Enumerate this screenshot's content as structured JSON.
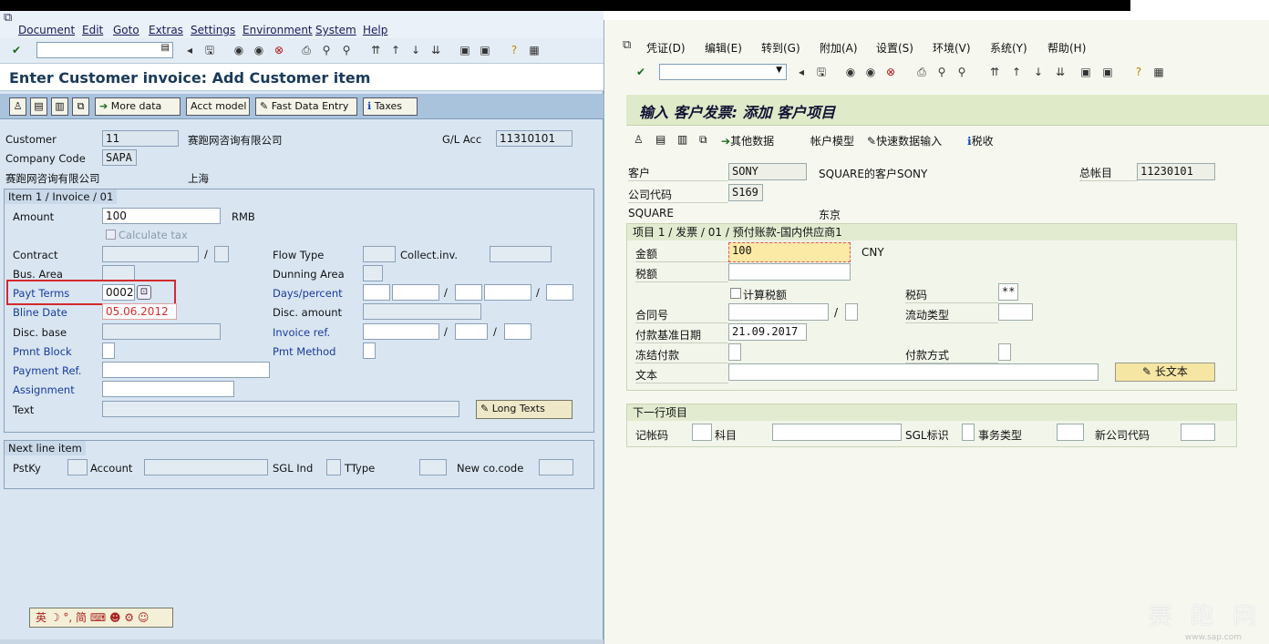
{
  "left": {
    "menu": [
      "Document",
      "Edit",
      "Goto",
      "Extras",
      "Settings",
      "Environment",
      "System",
      "Help"
    ],
    "title": "Enter Customer invoice: Add Customer item",
    "buttons": {
      "more_data": "More data",
      "acct_model": "Acct model",
      "fast_entry": "Fast Data Entry",
      "taxes": "Taxes",
      "long_texts": "Long Texts"
    },
    "header": {
      "customer_label": "Customer",
      "customer_value": "11",
      "customer_name": "赛跑网咨询有限公司",
      "gl_label": "G/L Acc",
      "gl_value": "11310101",
      "company_label": "Company Code",
      "company_value": "SAPA",
      "addr_name": "赛跑网咨询有限公司",
      "addr_city": "上海"
    },
    "item_group": {
      "title": "Item 1 / Invoice / 01",
      "amount_label": "Amount",
      "amount_value": "100",
      "currency": "RMB",
      "calc_tax": "Calculate tax",
      "contract_label": "Contract",
      "flow_type_label": "Flow Type",
      "collect_inv_label": "Collect.inv.",
      "bus_area_label": "Bus. Area",
      "dunning_label": "Dunning Area",
      "payt_terms_label": "Payt Terms",
      "payt_terms_value": "0002",
      "days_percent_label": "Days/percent",
      "bline_label": "Bline Date",
      "bline_value": "05.06.2012",
      "disc_amount_label": "Disc. amount",
      "disc_base_label": "Disc. base",
      "invoice_ref_label": "Invoice ref.",
      "pmnt_block_label": "Pmnt Block",
      "pmt_method_label": "Pmt Method",
      "payment_ref_label": "Payment Ref.",
      "assignment_label": "Assignment",
      "text_label": "Text"
    },
    "next_line": {
      "title": "Next line item",
      "pstky": "PstKy",
      "account": "Account",
      "sgl": "SGL Ind",
      "ttype": "TType",
      "new_co": "New co.code"
    },
    "ime": "英 ☽ °, 简 ⌨ ☻ ⚙ ☺"
  },
  "right": {
    "menu": [
      "凭证(D)",
      "编辑(E)",
      "转到(G)",
      "附加(A)",
      "设置(S)",
      "环境(V)",
      "系统(Y)",
      "帮助(H)"
    ],
    "title": "输入 客户发票: 添加 客户项目",
    "buttons": {
      "other_data": "其他数据",
      "acct_model": "帐户模型",
      "fast_entry": "快速数据输入",
      "tax": "税收",
      "long_text": "长文本"
    },
    "header": {
      "customer_label": "客户",
      "customer_value": "SONY",
      "customer_desc": "SQUARE的客户SONY",
      "gl_label": "总帐目",
      "gl_value": "11230101",
      "company_label": "公司代码",
      "company_value": "S169",
      "addr_name": "SQUARE",
      "addr_city": "东京"
    },
    "item_group": {
      "title": "项目 1 / 发票 / 01 / 预付账款-国内供应商1",
      "amount_label": "金额",
      "amount_value": "100",
      "currency": "CNY",
      "tax_label": "税额",
      "calc_tax": "计算税额",
      "tax_code_label": "税码",
      "tax_code_value": "**",
      "contract_label": "合同号",
      "flow_label": "流动类型",
      "baseline_label": "付款基准日期",
      "baseline_value": "21.09.2017",
      "block_label": "冻结付款",
      "method_label": "付款方式",
      "text_label": "文本"
    },
    "next_line": {
      "title": "下一行项目",
      "pstky": "记帐码",
      "account": "科目",
      "sgl": "SGL标识",
      "ttype": "事务类型",
      "new_co": "新公司代码"
    },
    "watermark": "赛 跑 网",
    "watermark_url": "www.sap.com"
  }
}
